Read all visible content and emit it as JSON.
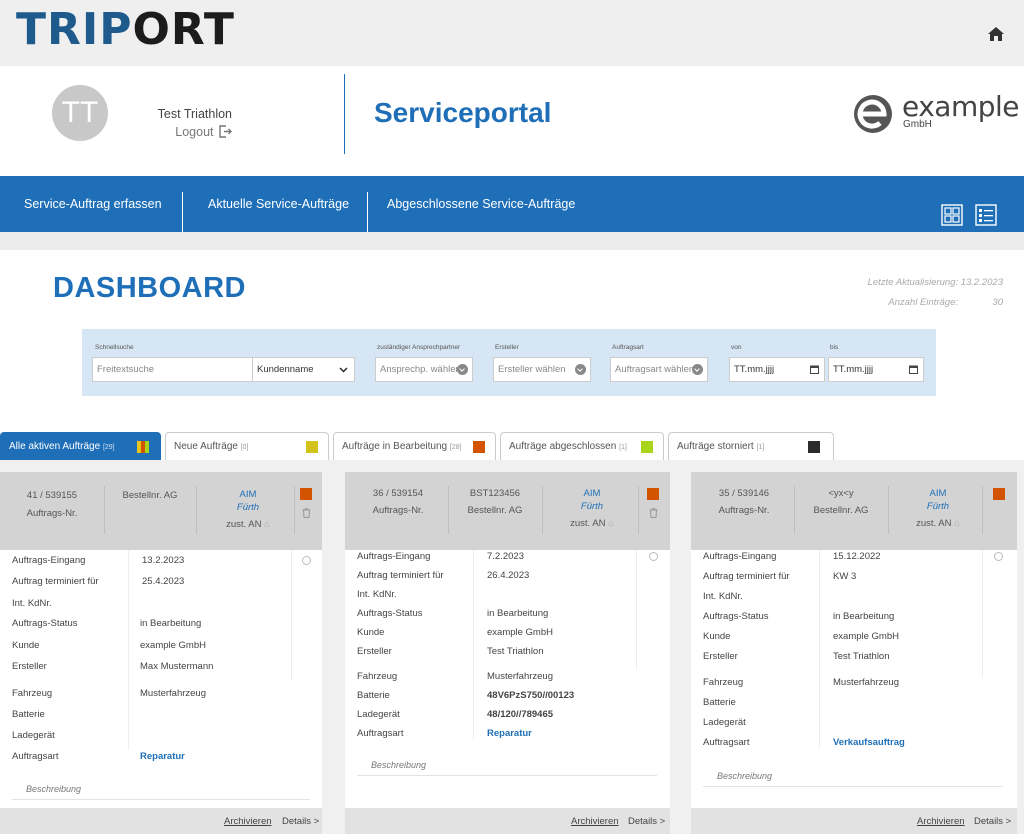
{
  "brand": {
    "logo_part1": "TRIP",
    "logo_part2": "RT",
    "logo_o": "O"
  },
  "header": {
    "avatar_initials": "TT",
    "username": "Test Triathlon",
    "logout_label": "Logout",
    "portal_title": "Serviceportal",
    "partner_logo_text": "example",
    "partner_logo_sub": "GmbH"
  },
  "nav": {
    "items": [
      {
        "label": "Service-Auftrag erfassen"
      },
      {
        "label": "Aktuelle Service-Aufträge"
      },
      {
        "label": "Abgeschlossene Service-Aufträge"
      }
    ]
  },
  "dashboard": {
    "title": "DASHBOARD",
    "last_update": "Letzte Aktualisierung: 13.2.2023",
    "entries_label": "Anzahl Einträge:",
    "entries_value": "30"
  },
  "filters": {
    "quicksearch_label": "Schnellsuche",
    "quicksearch_placeholder": "Freitextsuche",
    "field_select_value": "Kundenname",
    "contact_label": "zuständiger Ansprechpartner",
    "contact_value": "Ansprechp. wählen",
    "creator_label": "Ersteller",
    "creator_value": "Ersteller wählen",
    "type_label": "Auftragsart",
    "type_value": "Auftragsart wählen",
    "from_label": "von",
    "from_value": "TT.mm.jjjj",
    "to_label": "bis",
    "to_value": "TT.mm.jjjj"
  },
  "tabs": [
    {
      "label": "Alle aktiven Aufträge",
      "count": "[29]",
      "active": true,
      "swatch": "#e8c31a"
    },
    {
      "label": "Neue Aufträge",
      "count": "[0]",
      "active": false,
      "swatch": "#d4c31a"
    },
    {
      "label": "Aufträge in Bearbeitung",
      "count": "[28]",
      "active": false,
      "swatch": "#d35400"
    },
    {
      "label": "Aufträge abgeschlossen",
      "count": "[1]",
      "active": false,
      "swatch": "#a8d41a"
    },
    {
      "label": "Aufträge storniert",
      "count": "[1]",
      "active": false,
      "swatch": "#2c2c2c"
    }
  ],
  "labels": {
    "order_no": "Auftrags-Nr.",
    "po_no": "Bestellnr. AG",
    "aim": "AIM",
    "assignee": "zust. AN",
    "received": "Auftrags-Eingang",
    "scheduled": "Auftrag terminiert für",
    "int_customer_no": "Int. KdNr.",
    "status": "Auftrags-Status",
    "customer": "Kunde",
    "creator": "Ersteller",
    "vehicle": "Fahrzeug",
    "battery": "Batterie",
    "charger": "Ladegerät",
    "order_type": "Auftragsart",
    "description": "Beschreibung",
    "archive": "Archivieren",
    "details": "Details >"
  },
  "cards": [
    {
      "order_no": "41 / 539155",
      "po_no": "",
      "aim_location": "Fürth",
      "received": "13.2.2023",
      "scheduled": "25.4.2023",
      "int_customer_no": "",
      "status": "in Bearbeitung",
      "customer": "example GmbH",
      "creator": "Max Mustermann",
      "vehicle": "Musterfahrzeug",
      "battery": "",
      "charger": "",
      "order_type": "Reparatur"
    },
    {
      "order_no": "36 / 539154",
      "po_no": "BST123456",
      "aim_location": "Fürth",
      "received": "7.2.2023",
      "scheduled": "26.4.2023",
      "int_customer_no": "",
      "status": "in Bearbeitung",
      "customer": "example GmbH",
      "creator": "Test Triathlon",
      "vehicle": "Musterfahrzeug",
      "battery": "48V6PzS750//00123",
      "charger": "48/120//789465",
      "order_type": "Reparatur"
    },
    {
      "order_no": "35 / 539146",
      "po_no": "<ух<у",
      "aim_location": "Fürth",
      "received": "15.12.2022",
      "scheduled": "KW 3",
      "int_customer_no": "",
      "status": "in Bearbeitung",
      "customer": "example GmbH",
      "creator": "Test Triathlon",
      "vehicle": "Musterfahrzeug",
      "battery": "",
      "charger": "",
      "order_type": "Verkaufsauftrag"
    }
  ],
  "colors": {
    "primary": "#1e6fb8",
    "status_in_progress": "#d35400"
  }
}
